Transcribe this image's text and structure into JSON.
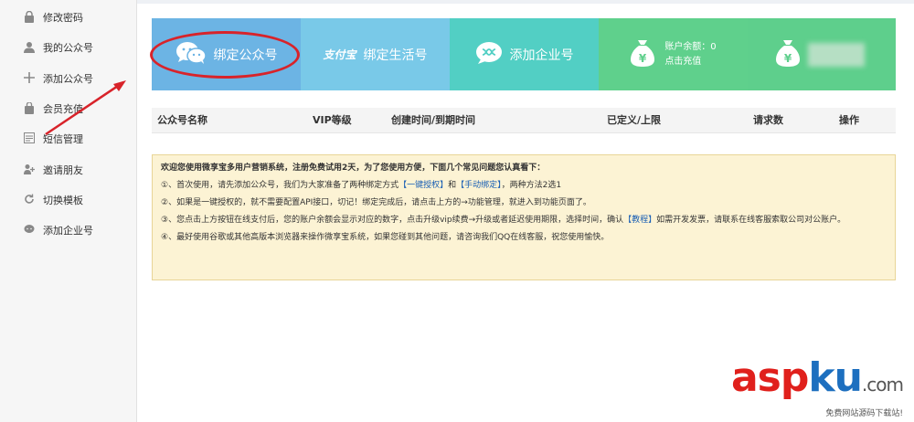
{
  "sidebar": {
    "items": [
      {
        "label": "修改密码",
        "icon": "lock-icon"
      },
      {
        "label": "我的公众号",
        "icon": "user-icon"
      },
      {
        "label": "添加公众号",
        "icon": "plus-icon"
      },
      {
        "label": "会员充值",
        "icon": "bag-icon"
      },
      {
        "label": "短信管理",
        "icon": "message-icon"
      },
      {
        "label": "邀请朋友",
        "icon": "invite-icon"
      },
      {
        "label": "切换模板",
        "icon": "refresh-icon"
      },
      {
        "label": "添加企业号",
        "icon": "chat-icon"
      }
    ]
  },
  "cards": {
    "bind_public": "绑定公众号",
    "bind_life_logo": "支付宝",
    "bind_life": "绑定生活号",
    "add_enterprise": "添加企业号",
    "balance_label": "账户余额：0",
    "recharge_label": "点击充值"
  },
  "table": {
    "headers": [
      "公众号名称",
      "VIP等级",
      "创建时间/到期时间",
      "已定义/上限",
      "请求数",
      "操作"
    ]
  },
  "notice": {
    "title": "欢迎您使用微享宝多用户营销系统，注册免费试用2天，为了您使用方便，下面几个常见问题您认真看下：",
    "item1_a": "①、首次使用，请先添加公众号，我们为大家准备了两种绑定方式",
    "item1_link1": "【一键授权】",
    "item1_b": "和",
    "item1_link2": "【手动绑定】",
    "item1_c": "，两种方法2选1",
    "item2": "②、如果是一键授权的，就不需要配置API接口，切记！绑定完成后，请点击上方的→功能管理，就进入到功能页面了。",
    "item3_a": "③、您点击上方按钮在线支付后，您的账户余额会显示对应的数字，点击升级vip续费→升级或者延迟使用期限，选择时间，确认",
    "item3_link": "【教程】",
    "item3_b": "如需开发发票，请联系在线客服索取公司对公账户。",
    "item4": "④、最好使用谷歌或其他高版本浏览器来操作微享宝系统，如果您碰到其他问题，请咨询我们QQ在线客服，祝您使用愉快。"
  },
  "watermark": {
    "asp": "asp",
    "ku": "ku",
    "com": ".com",
    "sub": "免费网站源码下载站!"
  },
  "colors": {
    "card_blue": "#6cb4e4",
    "card_lightblue": "#79c9e8",
    "card_teal": "#52cfc4",
    "card_green": "#5fd08c",
    "card_green2": "#5ecf8c",
    "annotation_red": "#d8232a"
  }
}
